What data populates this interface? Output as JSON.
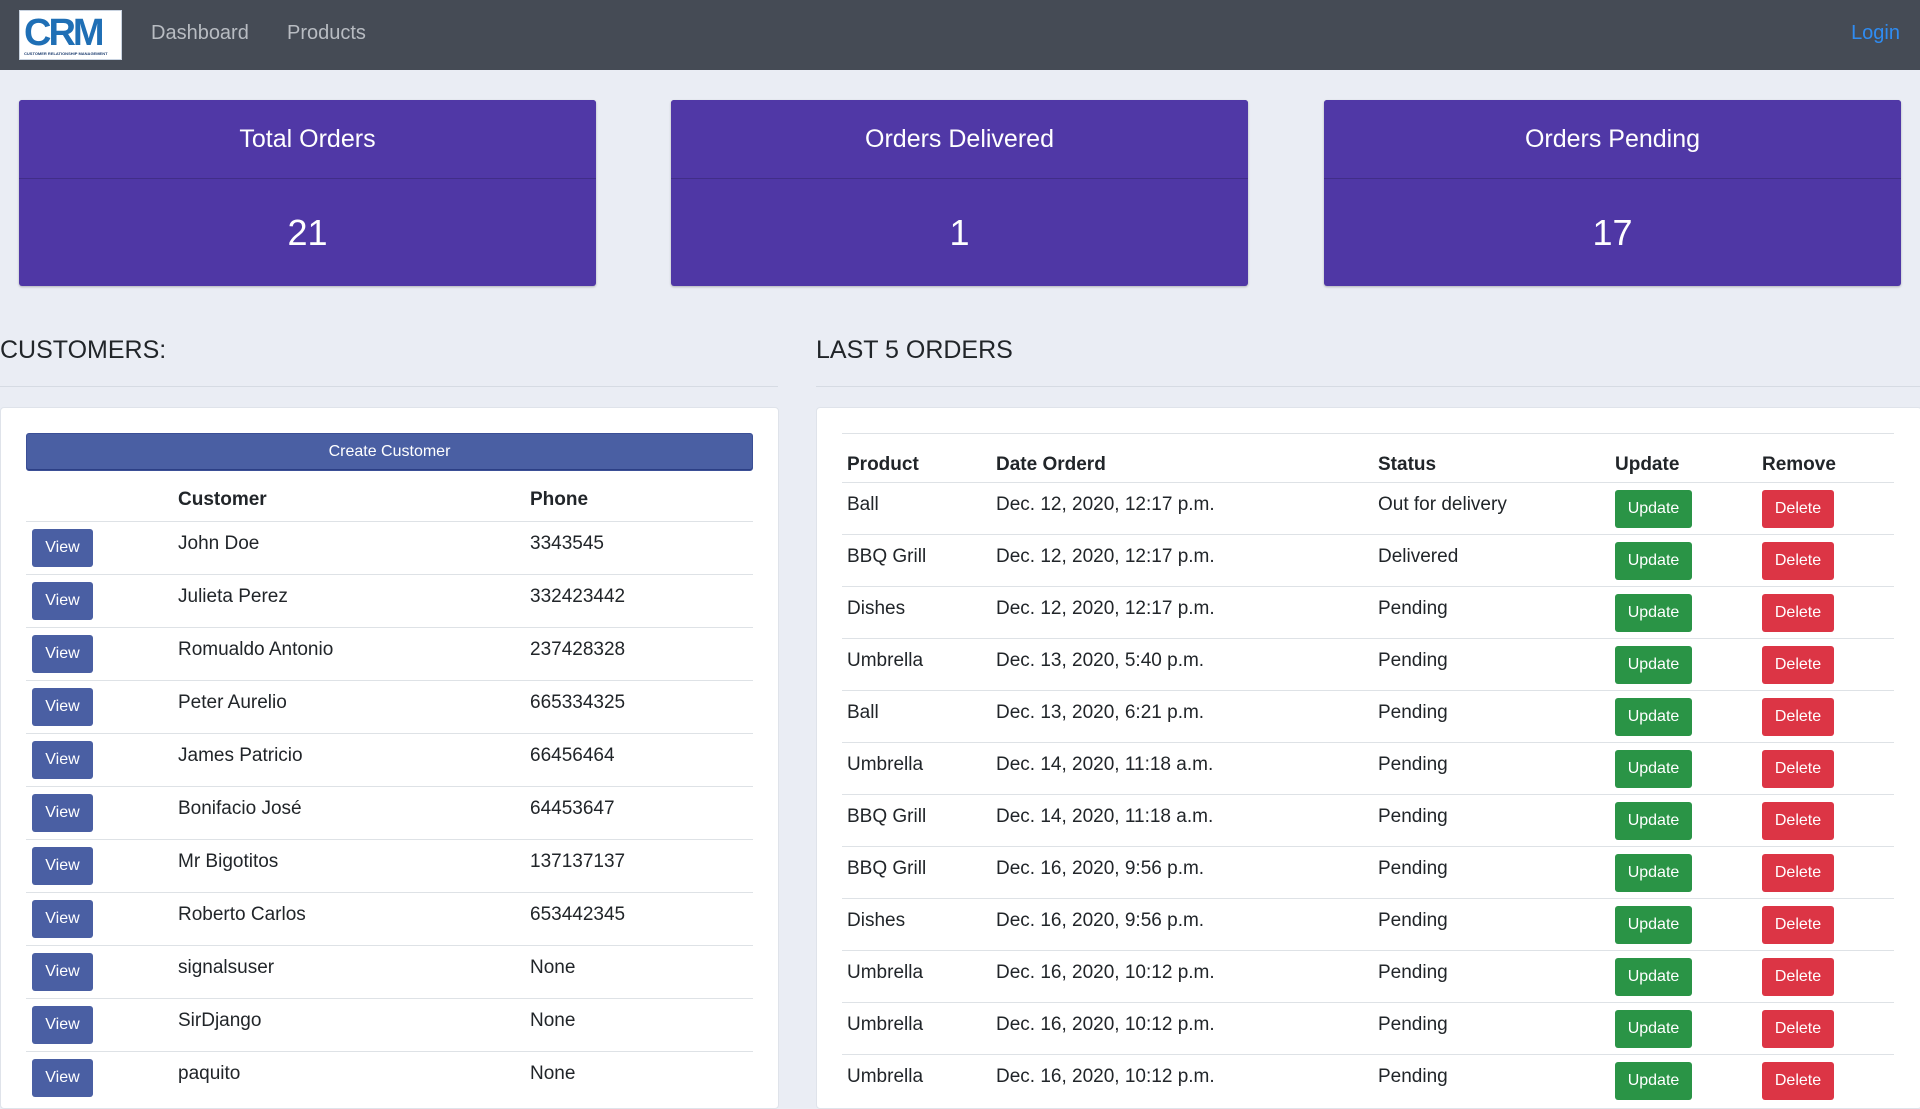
{
  "navbar": {
    "logo_text": "CRM",
    "logo_subtext": "CUSTOMER RELATIONSHIP MANAGEMENT",
    "links": [
      "Dashboard",
      "Products"
    ],
    "login": "Login"
  },
  "stats": [
    {
      "title": "Total Orders",
      "value": "21"
    },
    {
      "title": "Orders Delivered",
      "value": "1"
    },
    {
      "title": "Orders Pending",
      "value": "17"
    }
  ],
  "customers": {
    "heading": "CUSTOMERS:",
    "create_button": "Create Customer",
    "columns": [
      "",
      "Customer",
      "Phone"
    ],
    "view_label": "View",
    "rows": [
      {
        "name": "John Doe",
        "phone": "3343545"
      },
      {
        "name": "Julieta Perez",
        "phone": "332423442"
      },
      {
        "name": "Romualdo Antonio",
        "phone": "237428328"
      },
      {
        "name": "Peter Aurelio",
        "phone": "665334325"
      },
      {
        "name": "James Patricio",
        "phone": "66456464"
      },
      {
        "name": "Bonifacio José",
        "phone": "64453647"
      },
      {
        "name": "Mr Bigotitos",
        "phone": "137137137"
      },
      {
        "name": "Roberto Carlos",
        "phone": "653442345"
      },
      {
        "name": "signalsuser",
        "phone": "None"
      },
      {
        "name": "SirDjango",
        "phone": "None"
      },
      {
        "name": "paquito",
        "phone": "None"
      }
    ]
  },
  "orders": {
    "heading": "LAST 5 ORDERS",
    "columns": [
      "Product",
      "Date Orderd",
      "Status",
      "Update",
      "Remove"
    ],
    "update_label": "Update",
    "delete_label": "Delete",
    "rows": [
      {
        "product": "Ball",
        "date": "Dec. 12, 2020, 12:17 p.m.",
        "status": "Out for delivery"
      },
      {
        "product": "BBQ Grill",
        "date": "Dec. 12, 2020, 12:17 p.m.",
        "status": "Delivered"
      },
      {
        "product": "Dishes",
        "date": "Dec. 12, 2020, 12:17 p.m.",
        "status": "Pending"
      },
      {
        "product": "Umbrella",
        "date": "Dec. 13, 2020, 5:40 p.m.",
        "status": "Pending"
      },
      {
        "product": "Ball",
        "date": "Dec. 13, 2020, 6:21 p.m.",
        "status": "Pending"
      },
      {
        "product": "Umbrella",
        "date": "Dec. 14, 2020, 11:18 a.m.",
        "status": "Pending"
      },
      {
        "product": "BBQ Grill",
        "date": "Dec. 14, 2020, 11:18 a.m.",
        "status": "Pending"
      },
      {
        "product": "BBQ Grill",
        "date": "Dec. 16, 2020, 9:56 p.m.",
        "status": "Pending"
      },
      {
        "product": "Dishes",
        "date": "Dec. 16, 2020, 9:56 p.m.",
        "status": "Pending"
      },
      {
        "product": "Umbrella",
        "date": "Dec. 16, 2020, 10:12 p.m.",
        "status": "Pending"
      },
      {
        "product": "Umbrella",
        "date": "Dec. 16, 2020, 10:12 p.m.",
        "status": "Pending"
      },
      {
        "product": "Umbrella",
        "date": "Dec. 16, 2020, 10:12 p.m.",
        "status": "Pending"
      }
    ]
  },
  "colors": {
    "navbar": "#454b55",
    "stat_card": "#4f37a5",
    "primary_button": "#4a5fa3",
    "update_button": "#2a9446",
    "delete_button": "#dc3545",
    "login_link": "#2f8cf2"
  }
}
